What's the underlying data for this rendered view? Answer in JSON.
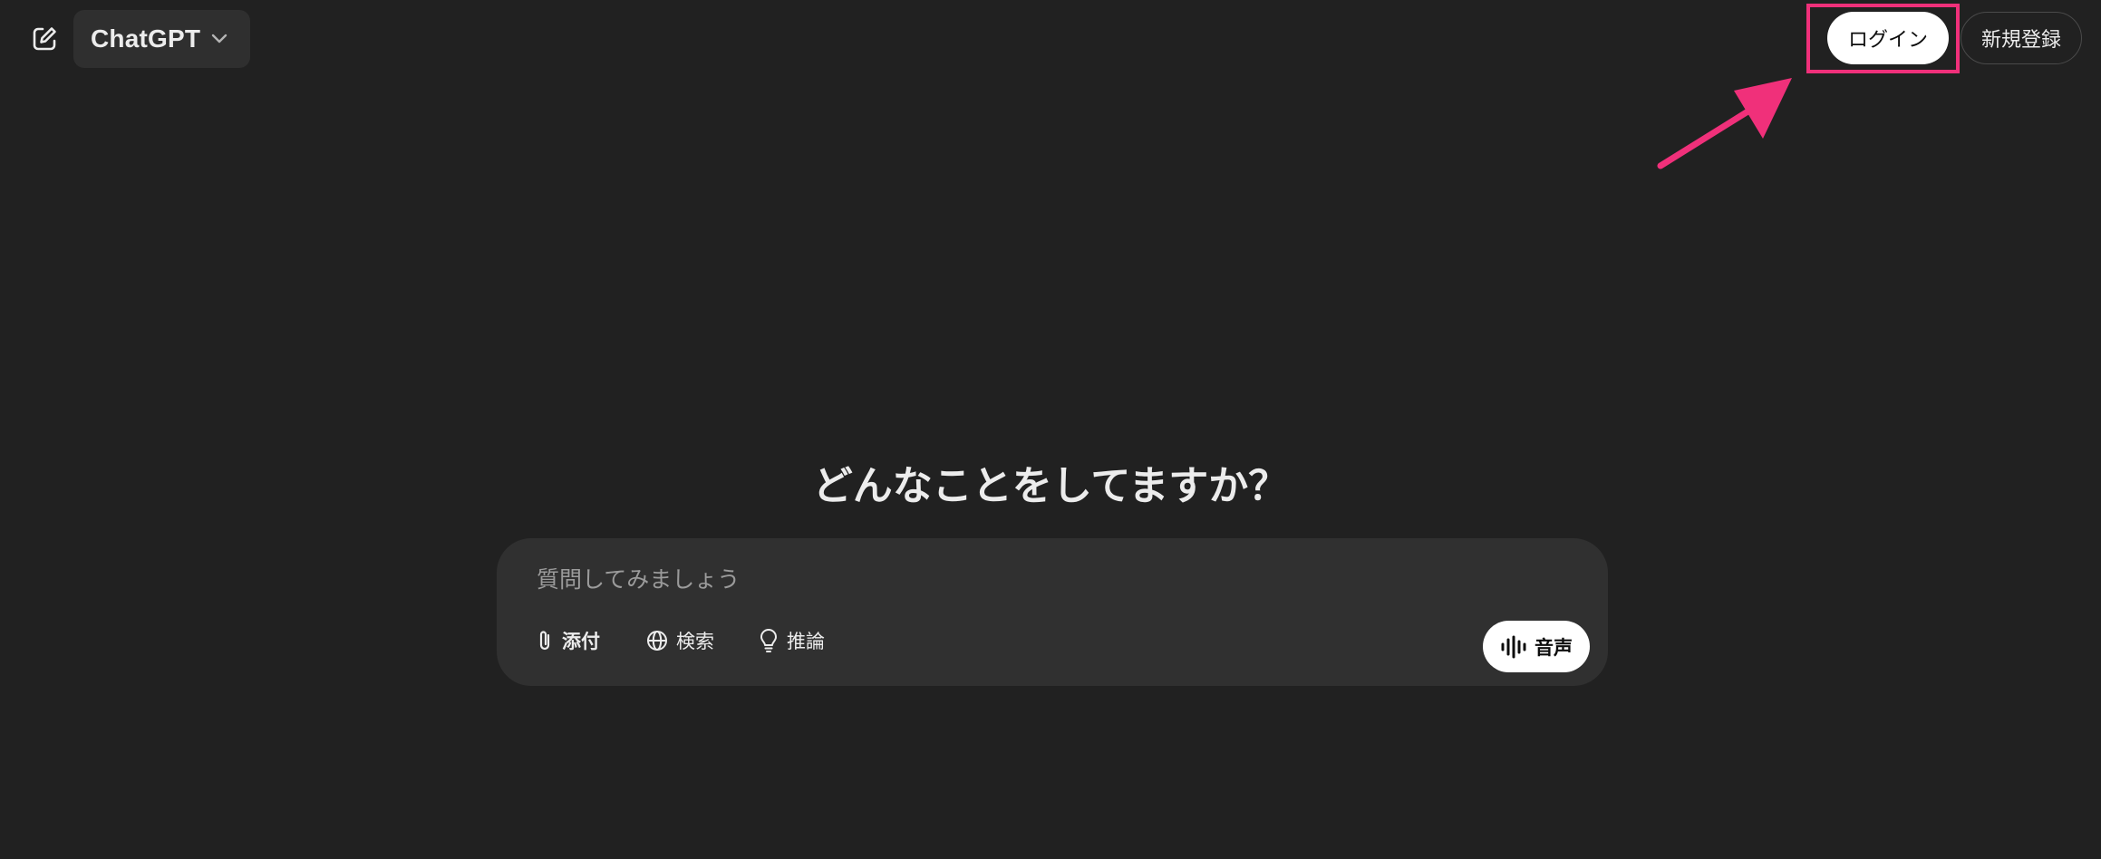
{
  "header": {
    "model_name": "ChatGPT",
    "login_label": "ログイン",
    "signup_label": "新規登録"
  },
  "main": {
    "headline": "どんなことをしてますか？",
    "composer": {
      "placeholder": "質問してみましょう",
      "tools": [
        {
          "label": "添付",
          "icon": "paperclip-icon"
        },
        {
          "label": "検索",
          "icon": "globe-icon"
        },
        {
          "label": "推論",
          "icon": "lightbulb-icon"
        }
      ],
      "voice_label": "音声"
    }
  },
  "annotation": {
    "highlight_color": "#f0307a"
  }
}
